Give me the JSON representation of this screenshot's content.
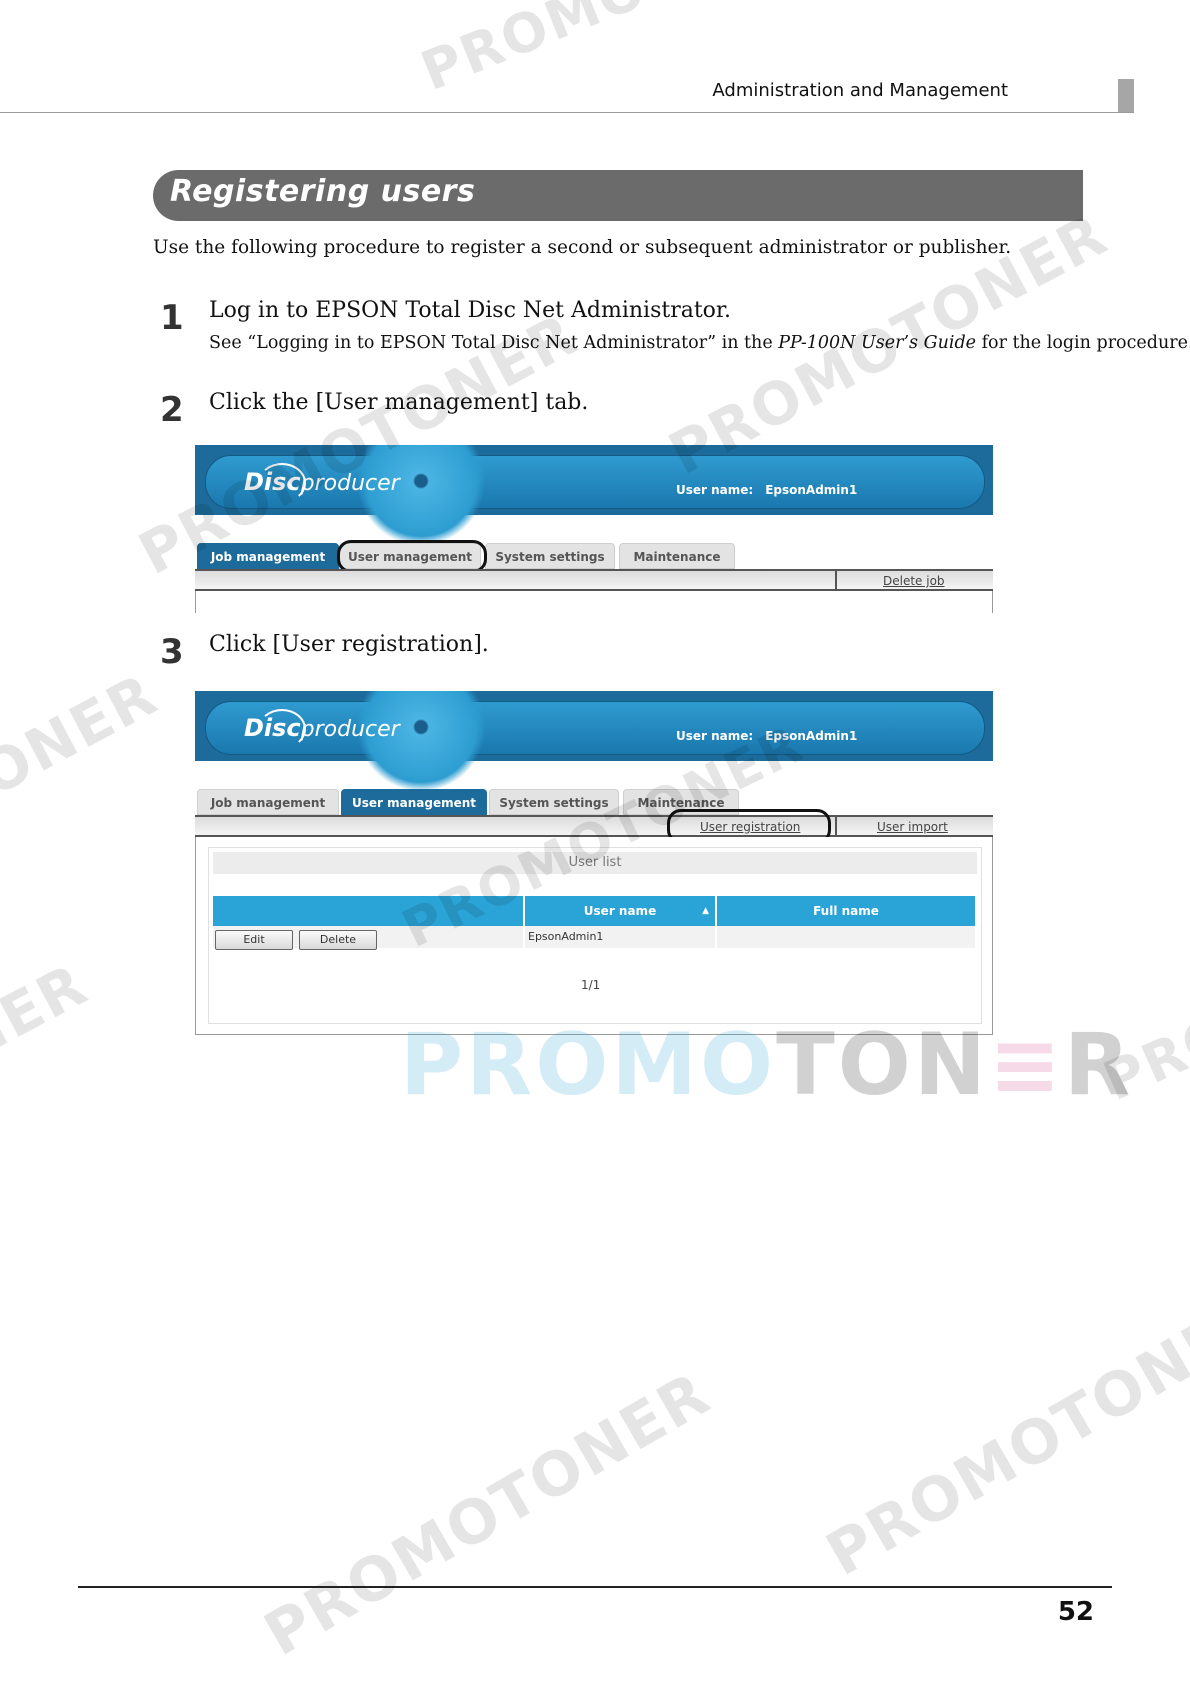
{
  "header": {
    "running_title": "Administration and Management"
  },
  "section": {
    "title": "Registering users",
    "intro": "Use the following procedure to register a second or subsequent administrator or publisher."
  },
  "steps": [
    {
      "number": "1",
      "text": "Log in to EPSON Total Disc Net Administrator.",
      "sub_before": "See “Logging in to EPSON Total Disc Net Administrator” in the ",
      "sub_italic": "PP-100N User’s Guide",
      "sub_after": " for the login procedure."
    },
    {
      "number": "2",
      "text": "Click the [User management] tab."
    },
    {
      "number": "3",
      "text": "Click [User registration]."
    }
  ],
  "app": {
    "logo_disc": "Disc",
    "logo_producer": "producer",
    "user_label": "User name:",
    "user_value": "EpsonAdmin1",
    "tabs": [
      "Job management",
      "User management",
      "System settings",
      "Maintenance"
    ]
  },
  "shot1": {
    "sub_link": "Delete job"
  },
  "shot2": {
    "sub_links": [
      "User registration",
      "User import"
    ],
    "list_title": "User list",
    "columns": [
      "User name",
      "Full name"
    ],
    "rows": [
      {
        "user_name": "EpsonAdmin1",
        "full_name": ""
      }
    ],
    "buttons": [
      "Edit",
      "Delete"
    ],
    "pager": "1/1"
  },
  "watermark": {
    "text": "PROMOTONER",
    "big_parts": [
      "PROMO",
      "TON",
      "≡",
      "R"
    ]
  },
  "footer": {
    "page_number": "52"
  }
}
